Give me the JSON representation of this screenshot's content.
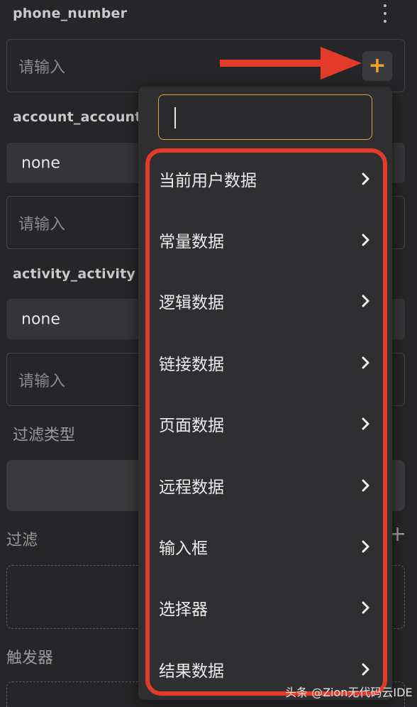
{
  "fields": {
    "phone_number_label": "phone_number",
    "phone_number_placeholder": "请输入",
    "account_label": "account_account",
    "account_value": "none",
    "account_placeholder": "请输入",
    "activity_label": "activity_activity",
    "activity_value": "none",
    "activity_placeholder": "请输入"
  },
  "sections": {
    "filter_type": "过滤类型",
    "filter": "过滤",
    "trigger": "触发器"
  },
  "buttons": {
    "add": "+",
    "filter_add": "+"
  },
  "dropdown": {
    "items": [
      {
        "label": "当前用户数据"
      },
      {
        "label": "常量数据"
      },
      {
        "label": "逻辑数据"
      },
      {
        "label": "链接数据"
      },
      {
        "label": "页面数据"
      },
      {
        "label": "远程数据"
      },
      {
        "label": "输入框"
      },
      {
        "label": "选择器"
      },
      {
        "label": "结果数据"
      }
    ]
  },
  "annotation": {
    "arrow_color": "#e23b2a",
    "outline_color": "#e23b2a"
  },
  "watermark": "头条 @Zion无代码云IDE"
}
